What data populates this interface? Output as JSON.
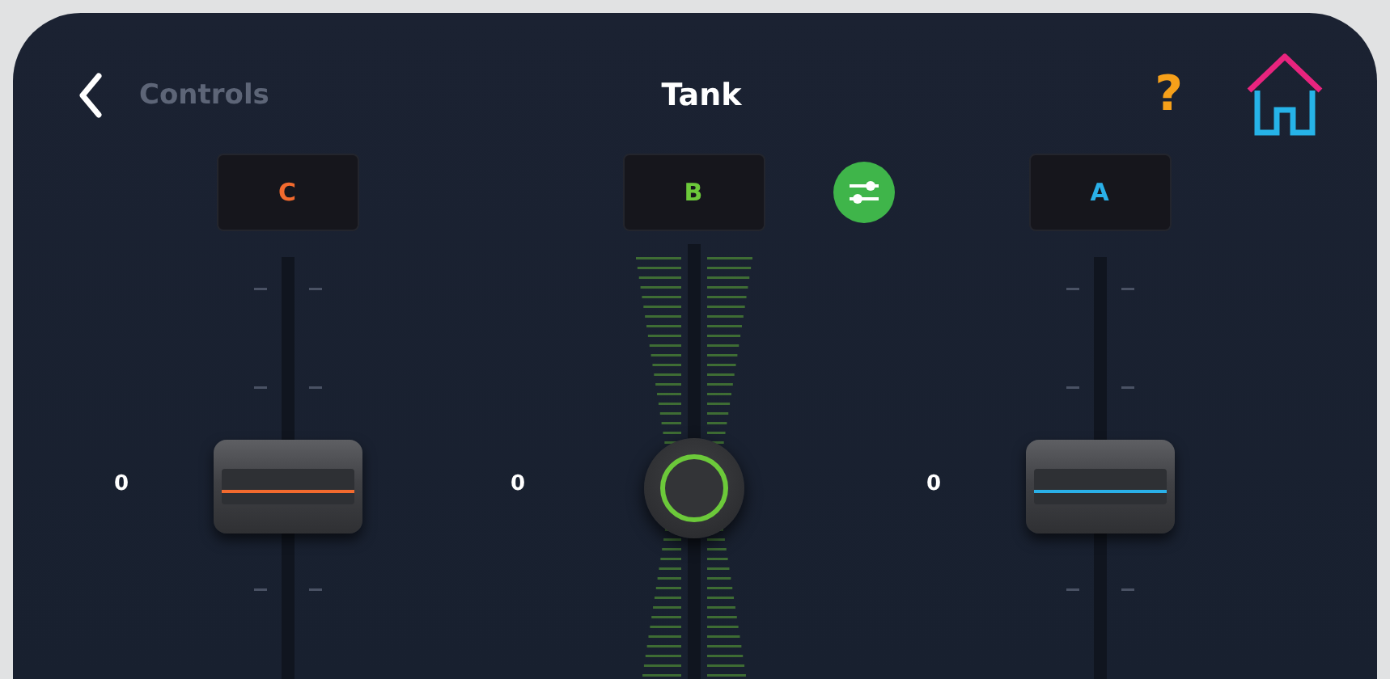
{
  "header": {
    "back_label": "Controls",
    "title": "Tank",
    "help": "?"
  },
  "channels": [
    {
      "label": "C",
      "kind": "fader",
      "color": "#f26a2e",
      "value": "0",
      "link_button": false
    },
    {
      "label": "B",
      "kind": "knob",
      "color": "#6cc93a",
      "value": "0",
      "link_button": true
    },
    {
      "label": "A",
      "kind": "fader",
      "color": "#2ab0e8",
      "value": "0",
      "link_button": false
    }
  ]
}
